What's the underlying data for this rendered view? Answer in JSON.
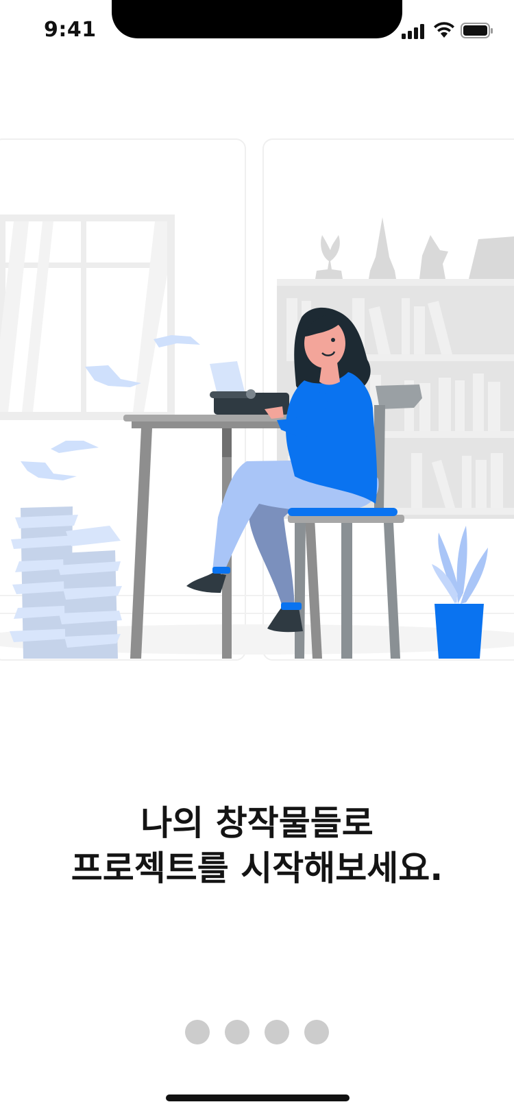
{
  "status_bar": {
    "time": "9:41",
    "icons": [
      "signal-icon",
      "wifi-icon",
      "battery-icon"
    ]
  },
  "illustration": {
    "name": "woman-typing-at-typewriter",
    "accent_color": "#0a73f0"
  },
  "onboarding": {
    "headline_line1": "나의 창작물들로",
    "headline_line2": "프로젝트를 시작해보세요.",
    "page_count": 4
  }
}
